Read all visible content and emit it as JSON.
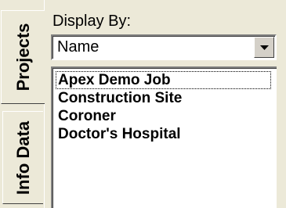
{
  "tabs": [
    {
      "label": "Projects",
      "selected": true
    },
    {
      "label": "Info Data",
      "selected": false
    }
  ],
  "display_by": {
    "label": "Display By:",
    "selected_value": "Name"
  },
  "projects_list": {
    "items": [
      {
        "label": "Apex Demo Job",
        "focused": true
      },
      {
        "label": "Construction Site",
        "focused": false
      },
      {
        "label": "Coroner",
        "focused": false
      },
      {
        "label": "Doctor's Hospital",
        "focused": false
      }
    ]
  },
  "icons": {
    "dropdown": "chevron-down-icon"
  }
}
